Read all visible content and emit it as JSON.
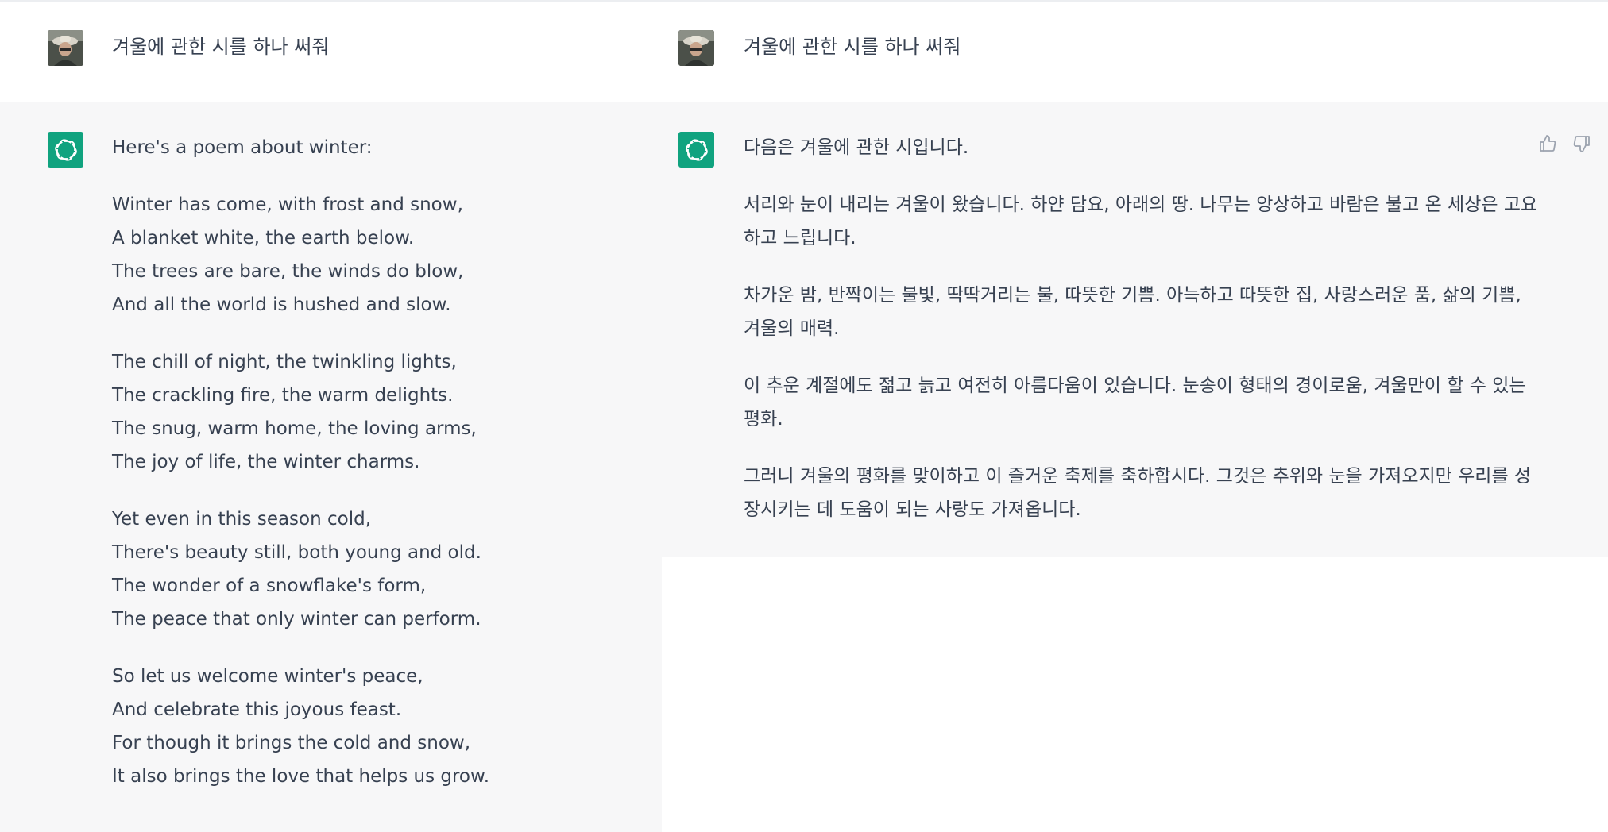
{
  "left": {
    "user_prompt": "겨울에 관한 시를 하나 써줘",
    "assistant_intro": "Here's a poem about winter:",
    "stanzas": [
      [
        "Winter has come, with frost and snow,",
        "A blanket white, the earth below.",
        "The trees are bare, the winds do blow,",
        "And all the world is hushed and slow."
      ],
      [
        "The chill of night, the twinkling lights,",
        "The crackling fire, the warm delights.",
        "The snug, warm home, the loving arms,",
        "The joy of life, the winter charms."
      ],
      [
        "Yet even in this season cold,",
        "There's beauty still, both young and old.",
        "The wonder of a snowflake's form,",
        "The peace that only winter can perform."
      ],
      [
        "So let us welcome winter's peace,",
        "And celebrate this joyous feast.",
        "For though it brings the cold and snow,",
        "It also brings the love that helps us grow."
      ]
    ]
  },
  "right": {
    "user_prompt": "겨울에 관한 시를 하나 써줘",
    "paragraphs": [
      "다음은 겨울에 관한 시입니다.",
      "서리와 눈이 내리는 겨울이 왔습니다. 하얀 담요, 아래의 땅. 나무는 앙상하고 바람은 불고 온 세상은 고요하고 느립니다.",
      "차가운 밤, 반짝이는 불빛, 딱딱거리는 불, 따뜻한 기쁨. 아늑하고 따뜻한 집, 사랑스러운 품, 삶의 기쁨, 겨울의 매력.",
      "이 추운 계절에도 젊고 늙고 여전히 아름다움이 있습니다. 눈송이 형태의 경이로움, 겨울만이 할 수 있는 평화.",
      "그러니 겨울의 평화를 맞이하고 이 즐거운 축제를 축하합시다. 그것은 추위와 눈을 가져오지만 우리를 성장시키는 데 도움이 되는 사랑도 가져옵니다."
    ]
  },
  "icons": {
    "assistant": "openai-logo-icon",
    "user": "user-avatar",
    "like": "thumbs-up-icon",
    "dislike": "thumbs-down-icon"
  },
  "colors": {
    "brand": "#10a37f",
    "assistant_bg": "#f7f7f8",
    "text": "#374151"
  }
}
